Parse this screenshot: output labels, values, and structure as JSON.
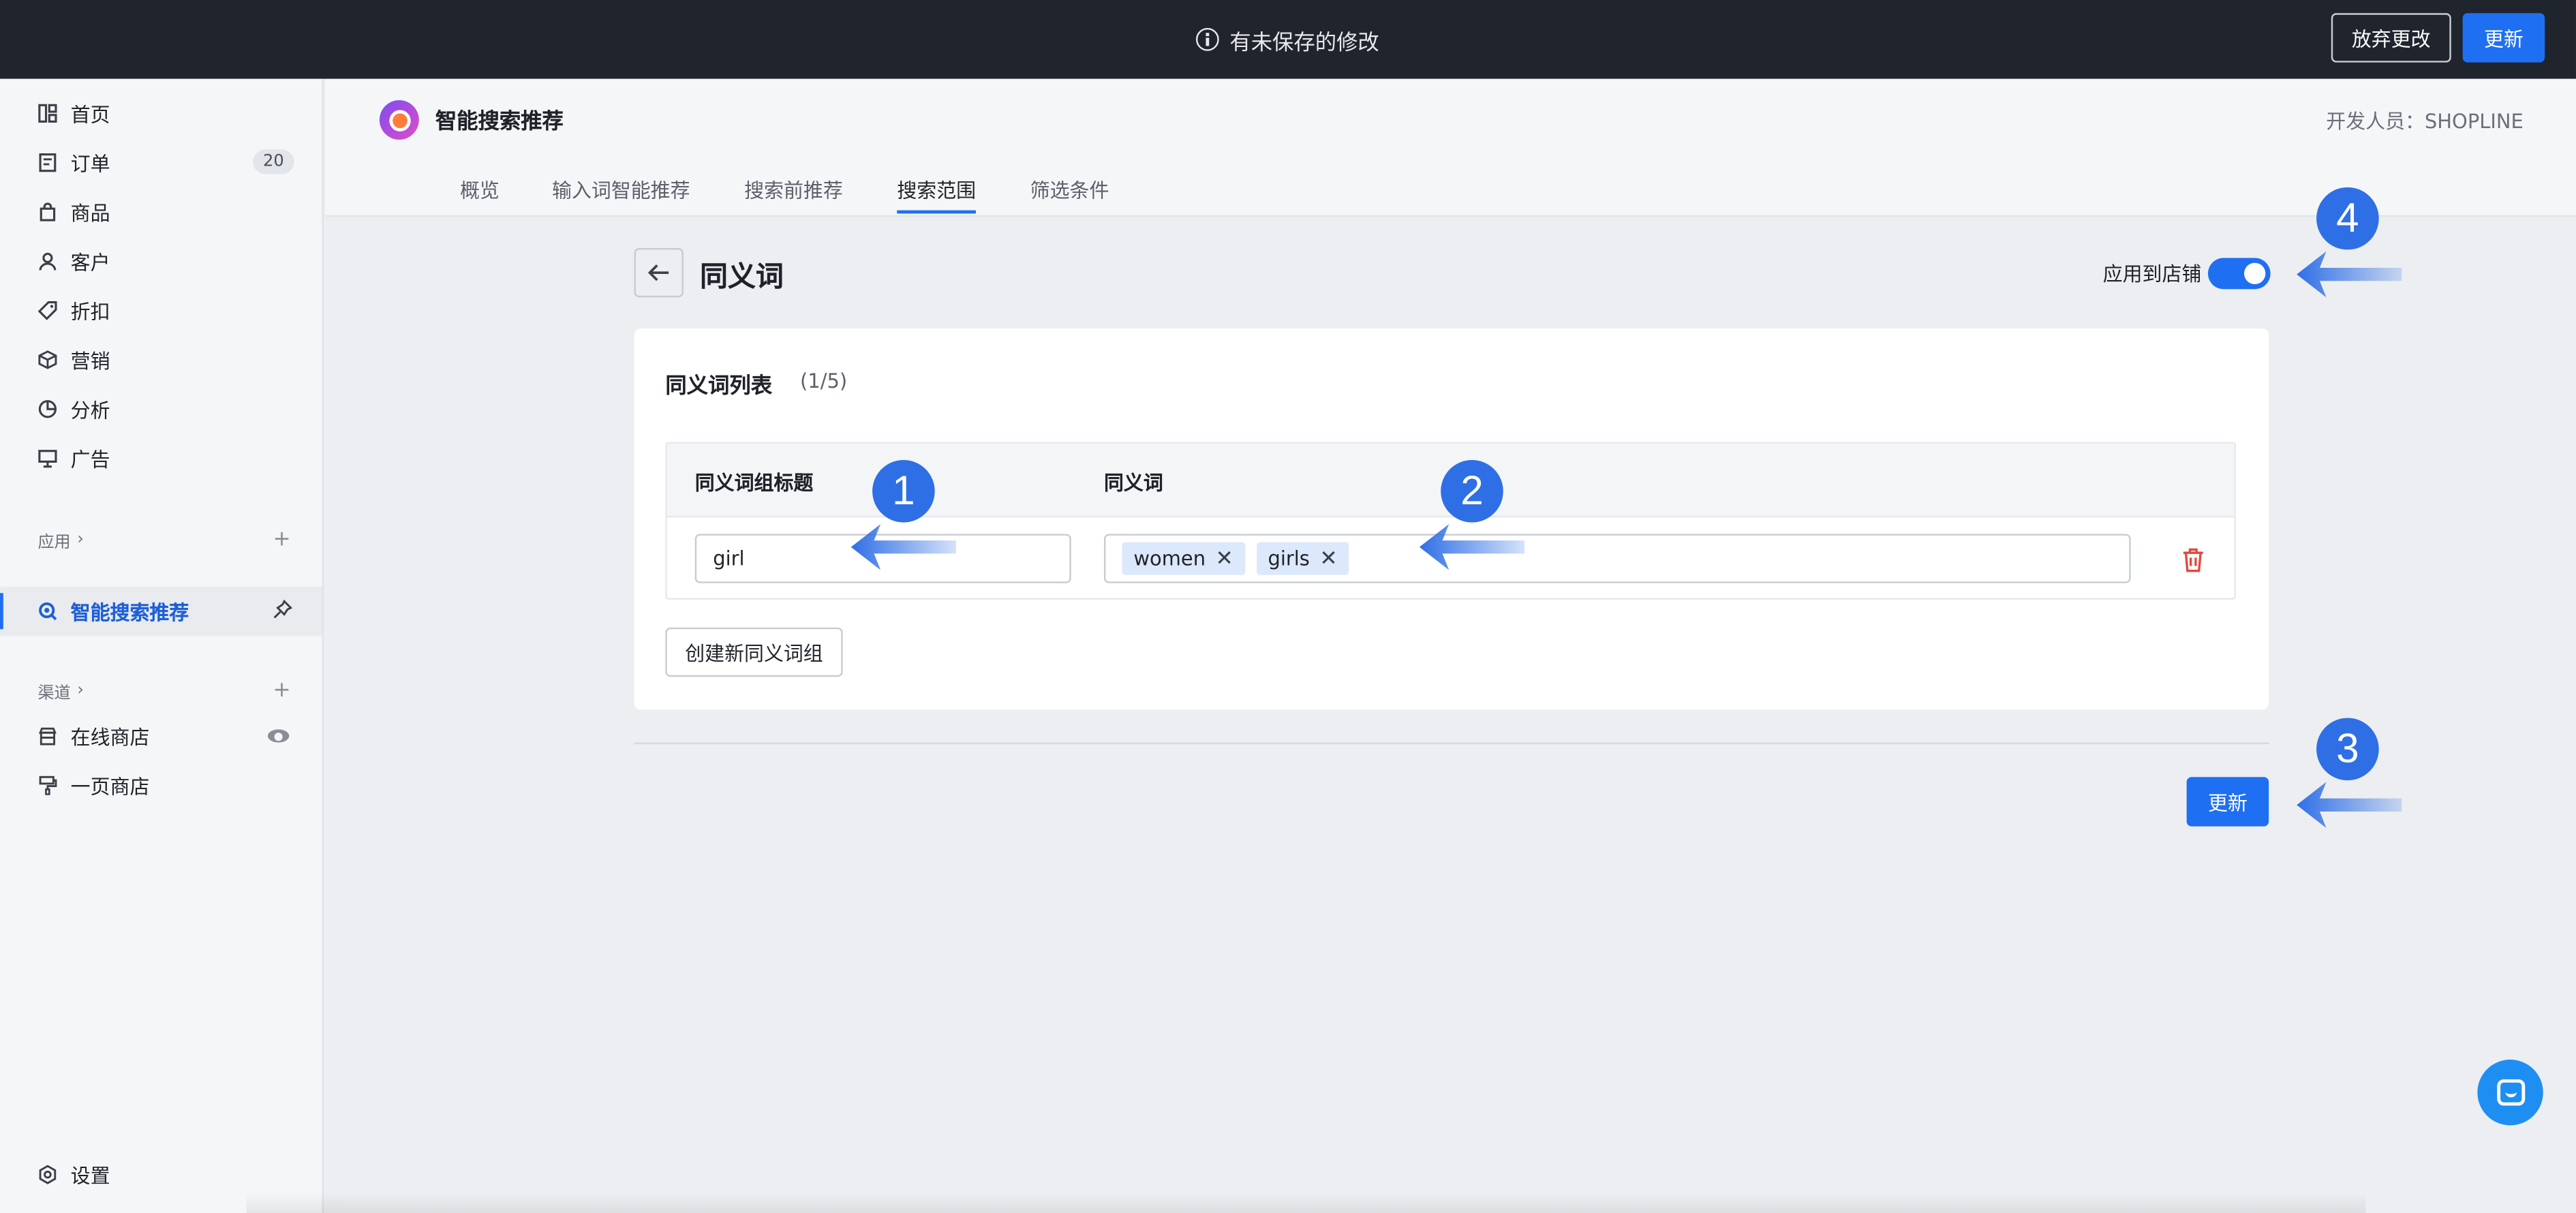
{
  "topbar": {
    "notice": "有未保存的修改",
    "discard_label": "放弃更改",
    "update_label": "更新"
  },
  "sidebar": {
    "items": [
      {
        "label": "首页",
        "icon": "dashboard-icon"
      },
      {
        "label": "订单",
        "icon": "order-icon",
        "badge": "20"
      },
      {
        "label": "商品",
        "icon": "bag-icon"
      },
      {
        "label": "客户",
        "icon": "user-icon"
      },
      {
        "label": "折扣",
        "icon": "tag-icon"
      },
      {
        "label": "营销",
        "icon": "cube-icon"
      },
      {
        "label": "分析",
        "icon": "pie-chart-icon"
      },
      {
        "label": "广告",
        "icon": "billboard-icon"
      }
    ],
    "apps_section": "应用",
    "active_app": "智能搜索推荐",
    "channels_section": "渠道",
    "channels": [
      {
        "label": "在线商店",
        "icon": "store-icon"
      },
      {
        "label": "一页商店",
        "icon": "roller-icon"
      }
    ],
    "settings": "设置"
  },
  "app_header": {
    "title": "智能搜索推荐",
    "developer": "开发人员：SHOPLINE",
    "tabs": [
      {
        "label": "概览",
        "active": false
      },
      {
        "label": "输入词智能推荐",
        "active": false
      },
      {
        "label": "搜索前推荐",
        "active": false
      },
      {
        "label": "搜索范围",
        "active": true
      },
      {
        "label": "筛选条件",
        "active": false
      }
    ]
  },
  "page": {
    "title": "同义词",
    "apply_label": "应用到店铺",
    "apply_enabled": true,
    "card_title": "同义词列表",
    "card_count": "(1/5)",
    "col_title": "同义词组标题",
    "col_synonyms": "同义词",
    "row": {
      "title_value": "girl",
      "tags": [
        "women",
        "girls"
      ]
    },
    "create_label": "创建新同义词组",
    "update_label": "更新"
  },
  "annotations": [
    "1",
    "2",
    "3",
    "4"
  ],
  "colors": {
    "accent": "#1f6ff2",
    "topbar": "#1f242d",
    "marker": "#2f6fe6",
    "danger": "#e5483b"
  }
}
